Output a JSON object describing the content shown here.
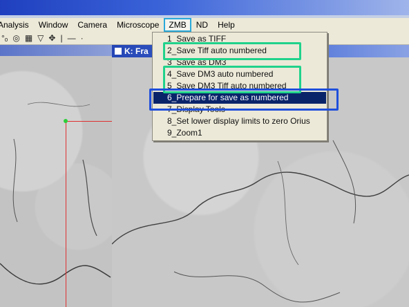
{
  "menubar": {
    "items": [
      "Analysis",
      "Window",
      "Camera",
      "Microscope",
      "ZMB",
      "ND",
      "Help"
    ],
    "open_menu": "ZMB"
  },
  "toolbar": {
    "icons": [
      "dots-icon",
      "target-icon",
      "grid-icon",
      "funnel-icon",
      "move-icon",
      "vline-icon",
      "hline-icon",
      "point-icon"
    ]
  },
  "image_window": {
    "title": "K: Fra"
  },
  "zmb_menu": {
    "items": [
      "1_Save as TIFF",
      "2_Save Tiff auto numbered",
      "3_Save as DM3",
      "4_Save DM3 auto numbered",
      "5_Save DM3 Tiff auto numbered",
      "6_Prepare for save as numbered",
      "7_Display Tools",
      "8_Set lower display limits to zero Orius",
      "9_Zoom1"
    ],
    "selected_index": 5
  },
  "colors": {
    "highlight_green": "#20d28c",
    "highlight_blue": "#1f4fdc",
    "menu_open_outline": "#2aa9d9",
    "selection": "#0a246a",
    "crosshair": "#e03030"
  }
}
